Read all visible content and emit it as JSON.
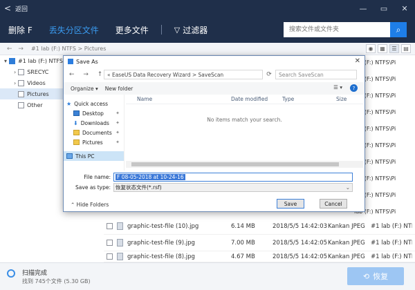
{
  "titlebar": {
    "back": "<",
    "title": "返回",
    "minimize": "—",
    "restore": "▭",
    "close": "✕"
  },
  "nav": {
    "tabs": [
      {
        "label": "删除 F"
      },
      {
        "label": "丢失分区文件"
      },
      {
        "label": "更多文件"
      }
    ],
    "filter_label": "过滤器",
    "search_placeholder": "搜索文件或文件夹"
  },
  "breadcrumb": {
    "arrows": "← →",
    "path": "#1 lab (F:) NTFS > Pictures"
  },
  "tree": [
    {
      "label": "#1 lab (F:) NTFS",
      "checked": true
    },
    {
      "label": "SRECYC",
      "checked": false
    },
    {
      "label": "Videos",
      "checked": false
    },
    {
      "label": "Pictures",
      "checked": false,
      "selected": true
    },
    {
      "label": "Other",
      "checked": false
    }
  ],
  "right_paths": [
    "lab (F:) NTFS\\Pi",
    "lab (F:) NTFS\\Pi",
    "lab (F:) NTFS\\Pi",
    "lab (F:) NTFS\\Pi",
    "lab (F:) NTFS\\Pi",
    "lab (F:) NTFS\\Pi",
    "lab (F:) NTFS\\Pi",
    "lab (F:) NTFS\\Pi",
    "lab (F:) NTFS\\Pi",
    "lab (F:) NTFS\\Pi"
  ],
  "files": [
    {
      "name": "graphic-test-file (10).jpg",
      "size": "6.14 MB",
      "date": "2018/5/5 14:42:03",
      "type": "Kankan JPEG",
      "path": "#1 lab (F:) NTFS\\Pi"
    },
    {
      "name": "graphic-test-file (9).jpg",
      "size": "7.00 MB",
      "date": "2018/5/5 14:42:05",
      "type": "Kankan JPEG",
      "path": "#1 lab (F:) NTFS\\Pi"
    },
    {
      "name": "graphic-test-file (8).jpg",
      "size": "4.67 MB",
      "date": "2018/5/5 14:42:05",
      "type": "Kankan JPEG",
      "path": "#1 lab (F:) NTFS\\Pi"
    }
  ],
  "status": {
    "title": "扫描完成",
    "subtitle": "找到 745个文件 (5.30 GB)",
    "recover_label": "恢复"
  },
  "dialog": {
    "title": "Save As",
    "close": "✕",
    "nav_arrows": "← → ↑",
    "address": "« EaseUS Data Recovery Wizard > SaveScan",
    "search_placeholder": "Search SaveScan",
    "toolbar": {
      "organize": "Organize ▾",
      "new_folder": "New folder",
      "view": "☰ ▾",
      "help": "?"
    },
    "nav_items": [
      {
        "label": "Quick access",
        "icon": "star"
      },
      {
        "label": "Desktop",
        "icon": "folder-blue"
      },
      {
        "label": "Downloads",
        "icon": "download"
      },
      {
        "label": "Documents",
        "icon": "folder"
      },
      {
        "label": "Pictures",
        "icon": "folder"
      },
      {
        "label": "This PC",
        "icon": "pc"
      }
    ],
    "columns": [
      "Name",
      "Date modified",
      "Type",
      "Size"
    ],
    "empty_message": "No items match your search.",
    "filename_label": "File name:",
    "filename_value": "F 08-05-2018 at 10-24-16",
    "savetype_label": "Save as type:",
    "savetype_value": "恢复状态文件(*.rsf)",
    "hide_folders": "Hide Folders",
    "save_label": "Save",
    "cancel_label": "Cancel"
  }
}
